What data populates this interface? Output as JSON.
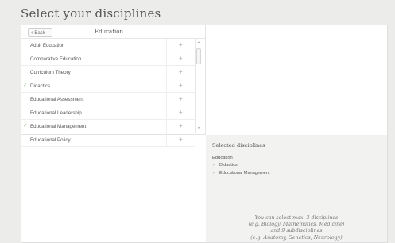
{
  "page": {
    "title": "Select your disciplines"
  },
  "browser": {
    "back_label": "Back",
    "back_icon": "chevron-left-icon",
    "header_title": "Education",
    "items": [
      {
        "label": "Adult Education",
        "checked": false
      },
      {
        "label": "Comparative Education",
        "checked": false
      },
      {
        "label": "Curriculum Theory",
        "checked": false
      },
      {
        "label": "Didactics",
        "checked": true
      },
      {
        "label": "Educational Assessment",
        "checked": false
      },
      {
        "label": "Educational Leadership",
        "checked": false
      },
      {
        "label": "Educational Management",
        "checked": true
      },
      {
        "label": "Educational Policy",
        "checked": false
      }
    ],
    "add_icon": "plus-icon"
  },
  "selected": {
    "title": "Selected disciplines",
    "group": "Education",
    "items": [
      {
        "label": "Didactics"
      },
      {
        "label": "Educational Management"
      }
    ],
    "note_lines": [
      "You can select max. 3 disciplines",
      "(e.g. Biology, Mathematics, Medicine)",
      "and 9 subdisciplines",
      "(e.g. Anatomy, Genetics, Neurology)"
    ]
  },
  "colors": {
    "check": "#a9c9a4",
    "background": "#ececea",
    "selected_panel": "#f2f2f0"
  }
}
